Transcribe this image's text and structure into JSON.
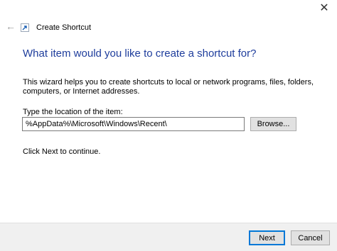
{
  "window": {
    "title": "Create Shortcut",
    "close_glyph": "✕",
    "back_glyph": "←",
    "icons": {
      "back": "back-arrow-icon",
      "close": "close-icon",
      "shortcut": "shortcut-icon"
    }
  },
  "main": {
    "heading": "What item would you like to create a shortcut for?",
    "description": "This wizard helps you to create shortcuts to local or network programs, files, folders, computers, or Internet addresses.",
    "location_label": "Type the location of the item:",
    "location_value": "%AppData%\\Microsoft\\Windows\\Recent\\",
    "browse_label": "Browse...",
    "continue_text": "Click Next to continue."
  },
  "footer": {
    "next_label": "Next",
    "cancel_label": "Cancel"
  },
  "colors": {
    "heading": "#1e3d9c",
    "footer_bg": "#f0f0f0",
    "button_bg": "#e1e1e1",
    "default_button_border": "#0078d7"
  }
}
